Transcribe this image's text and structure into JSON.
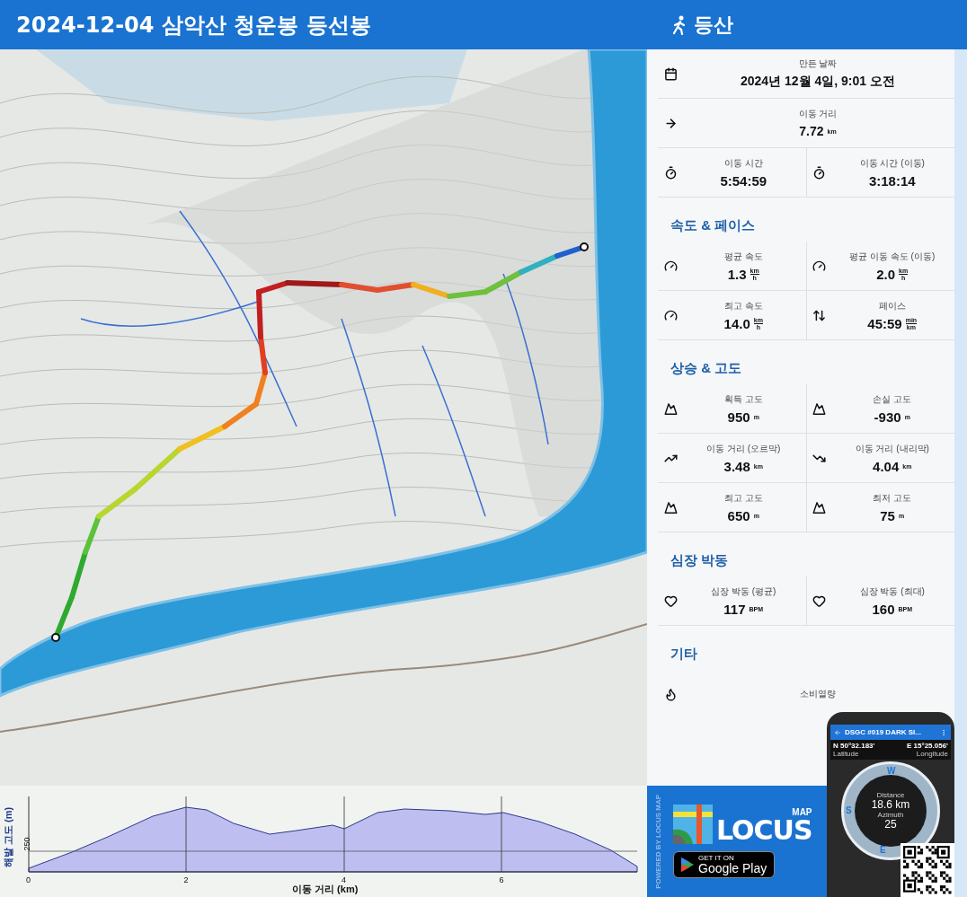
{
  "header": {
    "title": "2024-12-04 삼악산 청운봉 등선봉",
    "activity": "등산"
  },
  "stats": {
    "sections": [
      {
        "rows": [
          [
            {
              "label": "만든 날짜",
              "value": "2024년 12월 4일, 9:01 오전"
            }
          ],
          [
            {
              "label": "이동 거리",
              "value": "7.72",
              "unit": [
                "km"
              ]
            }
          ],
          [
            {
              "label": "이동 시간",
              "value": "5:54:59"
            },
            {
              "label": "이동 시간 (이동)",
              "value": "3:18:14"
            }
          ]
        ]
      },
      {
        "title": "속도 & 페이스",
        "rows": [
          [
            {
              "label": "평균 속도",
              "value": "1.3",
              "unit": [
                "km",
                "h"
              ]
            },
            {
              "label": "평균 이동 속도 (이동)",
              "value": "2.0",
              "unit": [
                "km",
                "h"
              ]
            }
          ],
          [
            {
              "label": "최고 속도",
              "value": "14.0",
              "unit": [
                "km",
                "h"
              ]
            },
            {
              "label": "페이스",
              "value": "45:59",
              "unit": [
                "min",
                "km"
              ]
            }
          ]
        ]
      },
      {
        "title": "상승 & 고도",
        "rows": [
          [
            {
              "label": "획득 고도",
              "value": "950",
              "unit": [
                "m"
              ]
            },
            {
              "label": "손실 고도",
              "value": "-930",
              "unit": [
                "m"
              ]
            }
          ],
          [
            {
              "label": "이동 거리 (오르막)",
              "value": "3.48",
              "unit": [
                "km"
              ]
            },
            {
              "label": "이동 거리 (내리막)",
              "value": "4.04",
              "unit": [
                "km"
              ]
            }
          ],
          [
            {
              "label": "최고 고도",
              "value": "650",
              "unit": [
                "m"
              ]
            },
            {
              "label": "최저 고도",
              "value": "75",
              "unit": [
                "m"
              ]
            }
          ]
        ]
      },
      {
        "title": "심장 박동",
        "rows": [
          [
            {
              "label": "심장 박동 (평균)",
              "value": "117",
              "unit": [
                "BPM"
              ]
            },
            {
              "label": "심장 박동 (최대)",
              "value": "160",
              "unit": [
                "BPM"
              ]
            }
          ]
        ]
      },
      {
        "title": "기타",
        "rows": [
          [
            {
              "label": "소비열량"
            }
          ]
        ]
      }
    ]
  },
  "elevation_profile": {
    "ylabel": "해발 고도 (m)",
    "ytick": "250",
    "xlabel": "이동 거리 (km)",
    "xticks": [
      "0",
      "2",
      "4",
      "6"
    ]
  },
  "ad": {
    "side_text": "POWERED BY LOCUS MAP",
    "logo_small": "MAP",
    "logo": "LOCUS",
    "store_top": "GET IT ON",
    "store": "Google Play",
    "phone": {
      "title": "DSGC #019 DARK SI...",
      "lat": "N 50°32.183'",
      "lat_label": "Latitude",
      "lon": "E 15°25.056'",
      "lon_label": "Longitude",
      "compass": [
        "W",
        "S",
        "E"
      ],
      "distance_label": "Distance",
      "distance": "18.6 km",
      "azimuth_label": "Azimuth",
      "azimuth": "25"
    }
  }
}
